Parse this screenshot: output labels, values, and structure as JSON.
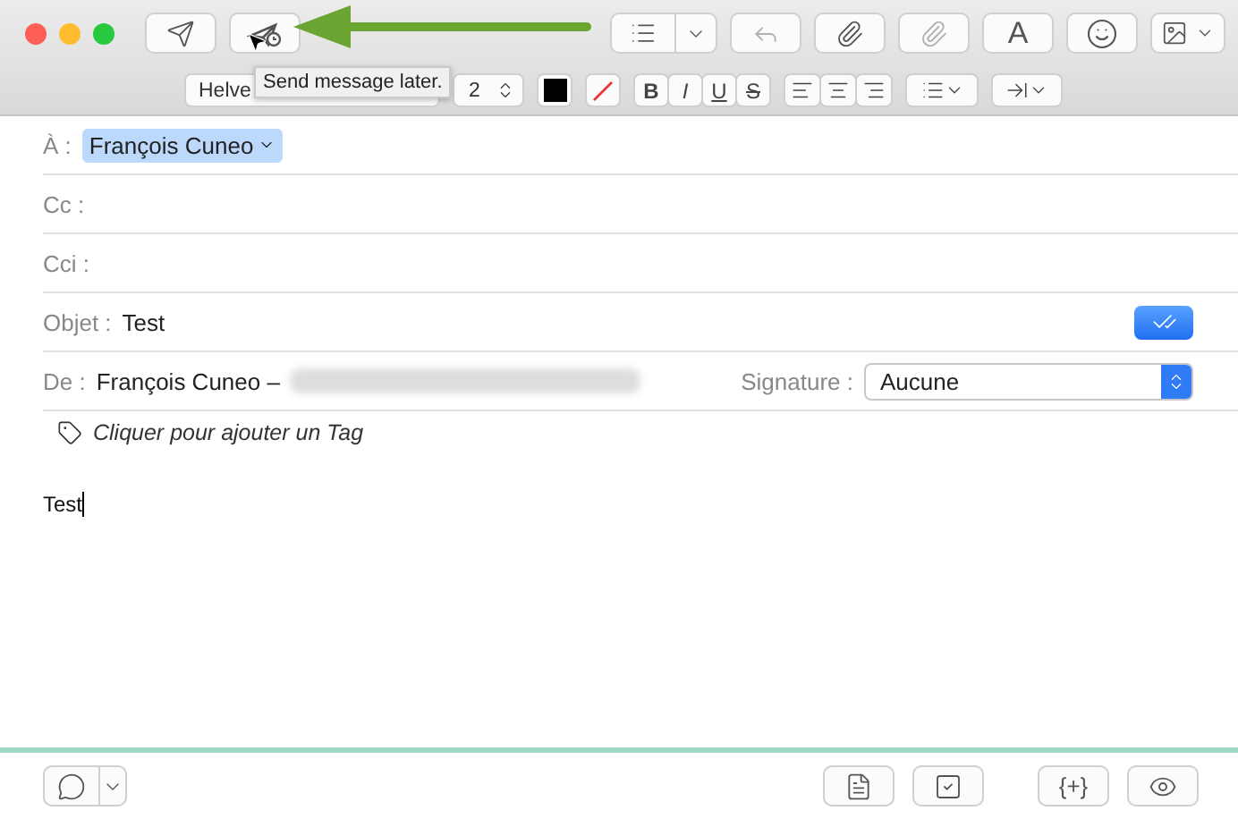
{
  "toolbar": {
    "buttons": [
      {
        "kind": "send"
      },
      {
        "kind": "send-later"
      },
      {
        "kind": "list-split"
      },
      {
        "kind": "reply",
        "disabled": true
      },
      {
        "kind": "attach"
      },
      {
        "kind": "markup",
        "disabled": true
      },
      {
        "kind": "fonts",
        "label": "A"
      },
      {
        "kind": "emoji"
      },
      {
        "kind": "photo"
      }
    ]
  },
  "tooltip": "Send message later.",
  "format_bar": {
    "font": "Helve",
    "size": "2",
    "style_buttons": [
      "B",
      "I",
      "U",
      "S"
    ]
  },
  "header": {
    "to": {
      "label": "À :",
      "recipient": "François Cuneo"
    },
    "cc": {
      "label": "Cc :"
    },
    "bcc": {
      "label": "Cci :"
    },
    "subject": {
      "label": "Objet :",
      "value": "Test"
    },
    "from": {
      "label": "De :",
      "value": "François Cuneo –"
    },
    "signature": {
      "label": "Signature :",
      "value": "Aucune"
    },
    "tag_hint": "Cliquer pour ajouter un Tag"
  },
  "body": "Test",
  "bottom_bar": {
    "buttons": [
      {
        "kind": "template"
      },
      {
        "kind": "check"
      },
      {
        "kind": "braces",
        "label": "{+}"
      },
      {
        "kind": "preview"
      }
    ]
  }
}
